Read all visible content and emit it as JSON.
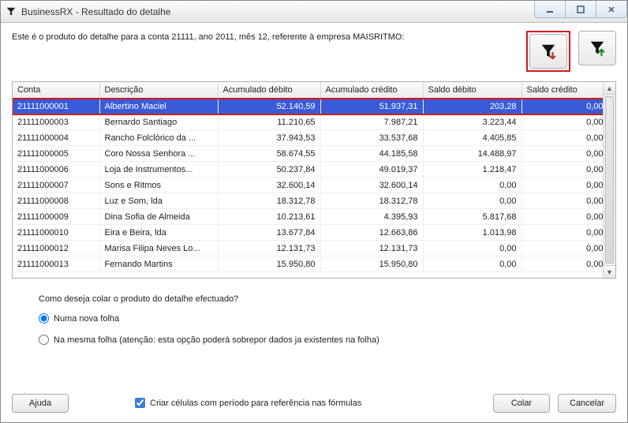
{
  "window": {
    "title": "BusinessRX - Resultado do detalhe"
  },
  "intro": "Este é o produto do detalhe para a conta 21111, ano 2011, mês 12, referente à empresa MAISRITMO:",
  "columns": {
    "c0": "Conta",
    "c1": "Descrição",
    "c2": "Acumulado débito",
    "c3": "Acumulado crédito",
    "c4": "Saldo débito",
    "c5": "Saldo crédito"
  },
  "rows": [
    {
      "conta": "21111000001",
      "desc": "Albertino Maciel",
      "ad": "52.140,59",
      "ac": "51.937,31",
      "sd": "203,28",
      "sc": "0,00"
    },
    {
      "conta": "21111000003",
      "desc": "Bernardo Santiago",
      "ad": "11.210,65",
      "ac": "7.987,21",
      "sd": "3.223,44",
      "sc": "0,00"
    },
    {
      "conta": "21111000004",
      "desc": "Rancho Folclórico da ...",
      "ad": "37.943,53",
      "ac": "33.537,68",
      "sd": "4.405,85",
      "sc": "0,00"
    },
    {
      "conta": "21111000005",
      "desc": "Coro Nossa Senhora ...",
      "ad": "58.674,55",
      "ac": "44.185,58",
      "sd": "14.488,97",
      "sc": "0,00"
    },
    {
      "conta": "21111000006",
      "desc": "Loja de Instrumentos...",
      "ad": "50.237,84",
      "ac": "49.019,37",
      "sd": "1.218,47",
      "sc": "0,00"
    },
    {
      "conta": "21111000007",
      "desc": "Sons e Ritmos",
      "ad": "32.600,14",
      "ac": "32.600,14",
      "sd": "0,00",
      "sc": "0,00"
    },
    {
      "conta": "21111000008",
      "desc": "Luz e Som, lda",
      "ad": "18.312,78",
      "ac": "18.312,78",
      "sd": "0,00",
      "sc": "0,00"
    },
    {
      "conta": "21111000009",
      "desc": "Dina Sofia de Almeida",
      "ad": "10.213,61",
      "ac": "4.395,93",
      "sd": "5.817,68",
      "sc": "0,00"
    },
    {
      "conta": "21111000010",
      "desc": "Eira e Beira, lda",
      "ad": "13.677,84",
      "ac": "12.663,86",
      "sd": "1.013,98",
      "sc": "0,00"
    },
    {
      "conta": "21111000012",
      "desc": "Marisa Filipa Neves Lo...",
      "ad": "12.131,73",
      "ac": "12.131,73",
      "sd": "0,00",
      "sc": "0,00"
    },
    {
      "conta": "21111000013",
      "desc": "Fernando Martins",
      "ad": "15.950,80",
      "ac": "15.950,80",
      "sd": "0,00",
      "sc": "0,00"
    }
  ],
  "question": {
    "text": "Como deseja colar o produto do detalhe efectuado?",
    "opt_new": "Numa nova folha",
    "opt_same": "Na mesma folha (atenção: esta opção poderá sobrepor dados ja existentes na folha)"
  },
  "checkbox": {
    "label": "Criar células com período para referência nas fórmulas"
  },
  "buttons": {
    "help": "Ajuda",
    "paste": "Colar",
    "cancel": "Cancelar"
  }
}
